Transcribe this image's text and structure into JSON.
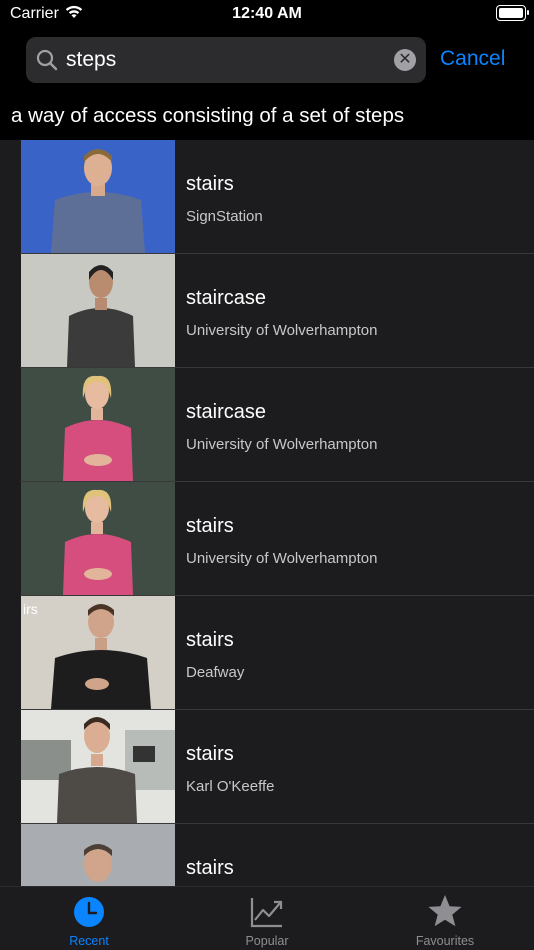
{
  "status": {
    "carrier": "Carrier",
    "time": "12:40 AM"
  },
  "search": {
    "value": "steps",
    "cancel_label": "Cancel"
  },
  "definition": "a way of access consisting of a set of steps",
  "results": [
    {
      "title": "stairs",
      "source": "SignStation"
    },
    {
      "title": "staircase",
      "source": "University of Wolverhampton"
    },
    {
      "title": "staircase",
      "source": "University of Wolverhampton"
    },
    {
      "title": "stairs",
      "source": "University of Wolverhampton"
    },
    {
      "title": "stairs",
      "source": "Deafway",
      "thumb_overlay": "irs"
    },
    {
      "title": "stairs",
      "source": "Karl O'Keeffe"
    },
    {
      "title": "stairs",
      "source": ""
    }
  ],
  "tabs": [
    {
      "label": "Recent",
      "icon": "clock-icon",
      "active": true
    },
    {
      "label": "Popular",
      "icon": "trend-chart-icon",
      "active": false
    },
    {
      "label": "Favourites",
      "icon": "star-icon",
      "active": false
    }
  ],
  "colors": {
    "accent": "#0a84ff",
    "cell_bg": "#1c1c1e",
    "inactive_tab": "#8e8e93"
  }
}
